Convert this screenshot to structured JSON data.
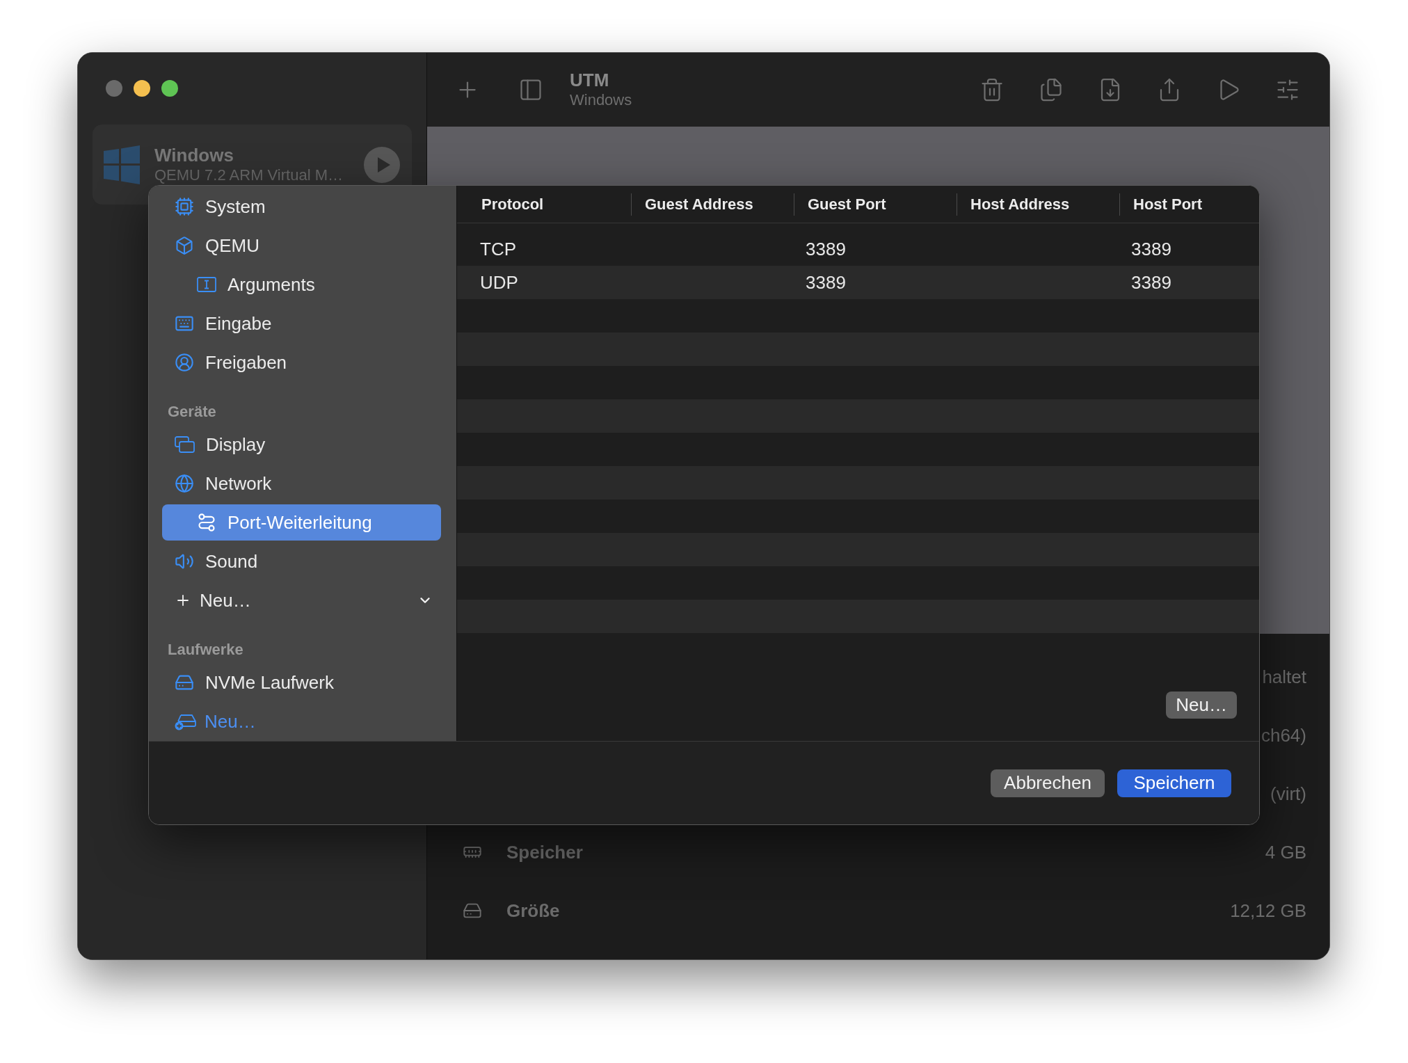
{
  "window": {
    "traffic_lights": [
      {
        "color": "#6a6a6a"
      },
      {
        "color": "#f4bf4f"
      },
      {
        "color": "#5fc454"
      }
    ]
  },
  "sidebar": {
    "vms": [
      {
        "name": "Windows",
        "subtitle": "QEMU 7.2 ARM Virtual M…"
      }
    ]
  },
  "toolbar": {
    "title": "UTM",
    "subtitle": "Windows"
  },
  "details": {
    "partial_values": [
      "haltet",
      "ch64)",
      "(virt)"
    ],
    "rows": [
      {
        "kind": "memory",
        "label": "Speicher",
        "value": "4 GB"
      },
      {
        "kind": "disk",
        "label": "Größe",
        "value": "12,12 GB"
      }
    ]
  },
  "settings_sheet": {
    "sidebar": {
      "sections": [
        {
          "items": [
            {
              "label": "System",
              "kind": "page",
              "selected": false
            },
            {
              "label": "QEMU",
              "kind": "page",
              "selected": false,
              "children": [
                {
                  "label": "Arguments",
                  "kind": "page",
                  "selected": false
                }
              ]
            },
            {
              "label": "Eingabe",
              "kind": "page",
              "selected": false
            },
            {
              "label": "Freigaben",
              "kind": "page",
              "selected": false
            }
          ]
        },
        {
          "title": "Geräte",
          "items": [
            {
              "label": "Display",
              "kind": "page",
              "selected": false
            },
            {
              "label": "Network",
              "kind": "page",
              "selected": false,
              "children": [
                {
                  "label": "Port-Weiterleitung",
                  "kind": "page",
                  "selected": true
                }
              ]
            },
            {
              "label": "Sound",
              "kind": "page",
              "selected": false
            },
            {
              "label": "Neu…",
              "kind": "add_menu",
              "selected": false
            }
          ]
        },
        {
          "title": "Laufwerke",
          "items": [
            {
              "label": "NVMe Laufwerk",
              "kind": "page",
              "selected": false
            },
            {
              "label": "Neu…",
              "kind": "add_link",
              "selected": false
            }
          ]
        }
      ]
    },
    "port_table": {
      "columns": [
        "Protocol",
        "Guest Address",
        "Guest Port",
        "Host Address",
        "Host Port"
      ],
      "rows": [
        {
          "protocol": "TCP",
          "guest_port": "3389",
          "host_port": "3389",
          "selected": false
        },
        {
          "protocol": "UDP",
          "guest_port": "3389",
          "host_port": "3389",
          "selected": false
        }
      ]
    },
    "add_button": "Neu…",
    "buttons": [
      {
        "label": "Abbrechen",
        "kind": "cancel"
      },
      {
        "label": "Speichern",
        "kind": "default"
      }
    ]
  }
}
